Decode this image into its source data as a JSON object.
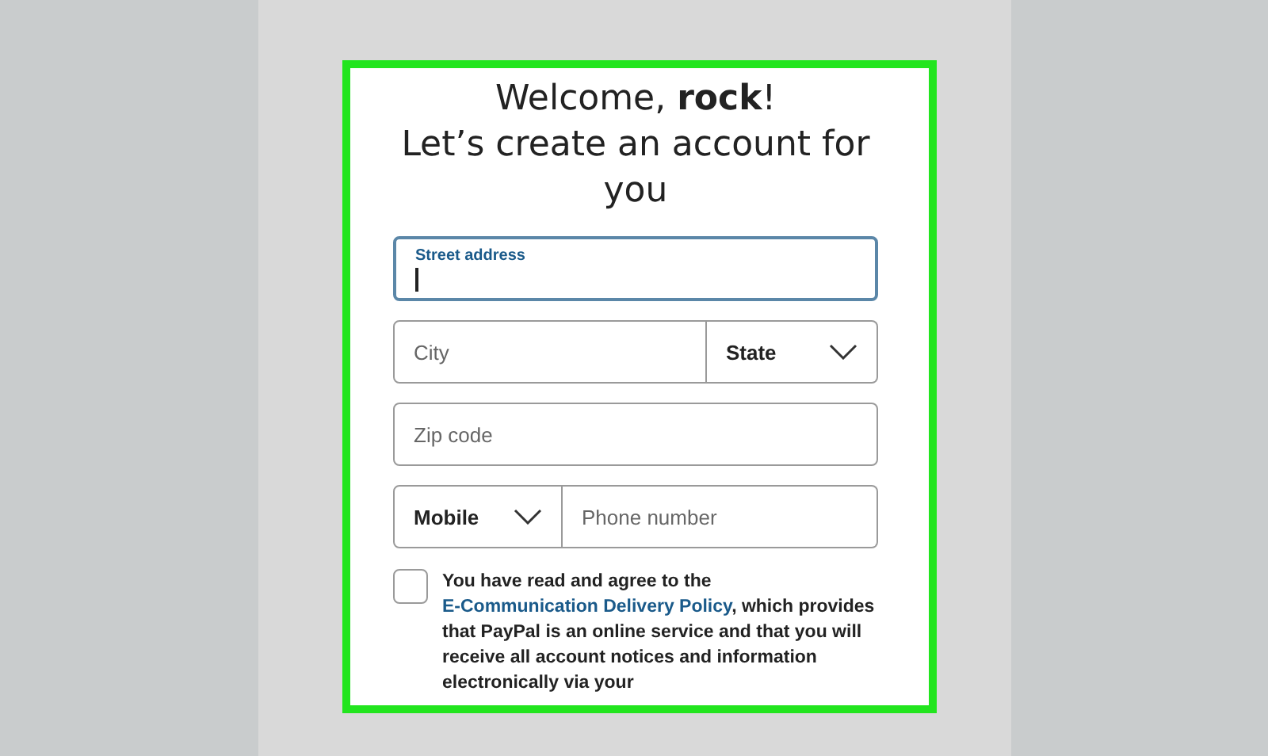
{
  "heading": {
    "greeting": "Welcome, **rock**!",
    "subtitle": "Let’s create an account for you"
  },
  "street": {
    "label": "Street address",
    "focused": true
  },
  "city": {
    "placeholder": "City"
  },
  "state": {
    "value": "State"
  },
  "zip": {
    "placeholder": "Zip code"
  },
  "phone_type": {
    "value": "Mobile"
  },
  "phone": {
    "placeholder": "Phone number"
  },
  "agreement": {
    "checked": false,
    "before": "You have read and agree to the",
    "link": "E-Communication Delivery Policy",
    "after": ", which provides that PayPal is an online service and that you will receive all account notices and information electronically via your"
  }
}
